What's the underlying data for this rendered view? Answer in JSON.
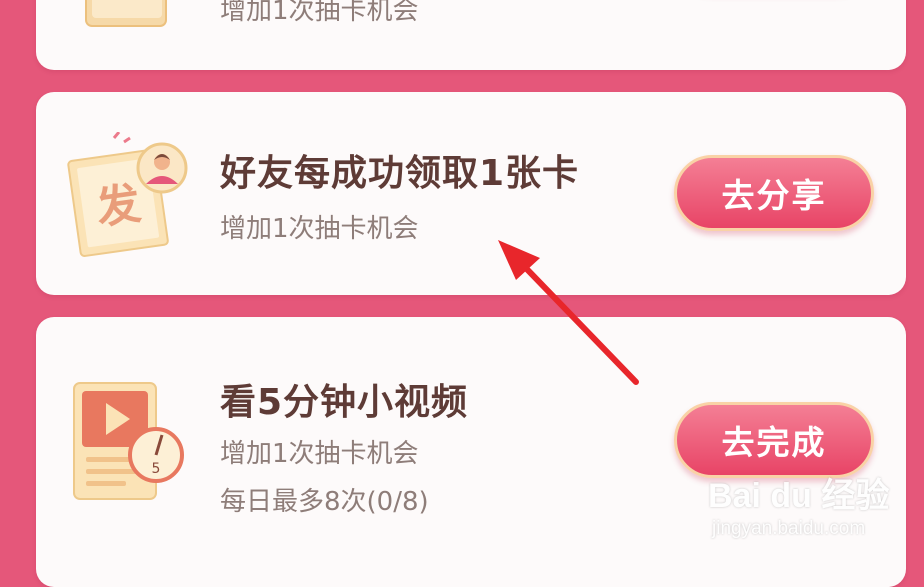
{
  "tasks": [
    {
      "subtitle": "增加1次抽卡机会",
      "button_label": ""
    },
    {
      "title": "好友每成功领取1张卡",
      "subtitle": "增加1次抽卡机会",
      "button_label": "去分享",
      "icon_glyph": "发",
      "icon": "share-card-icon"
    },
    {
      "title": "看5分钟小视频",
      "subtitle": "增加1次抽卡机会",
      "limit_text": "每日最多8次(0/8)",
      "button_label": "去完成",
      "icon_timer_label": "5",
      "icon": "video-timer-icon"
    }
  ],
  "watermark": {
    "brand": "Bai du 经验",
    "url": "jingyan.baidu.com"
  },
  "colors": {
    "background": "#e5577a",
    "card": "#fdfafa",
    "button": "#e84466",
    "title": "#5e3b36",
    "subtitle": "#8e7d79",
    "arrow": "#e8262b"
  }
}
